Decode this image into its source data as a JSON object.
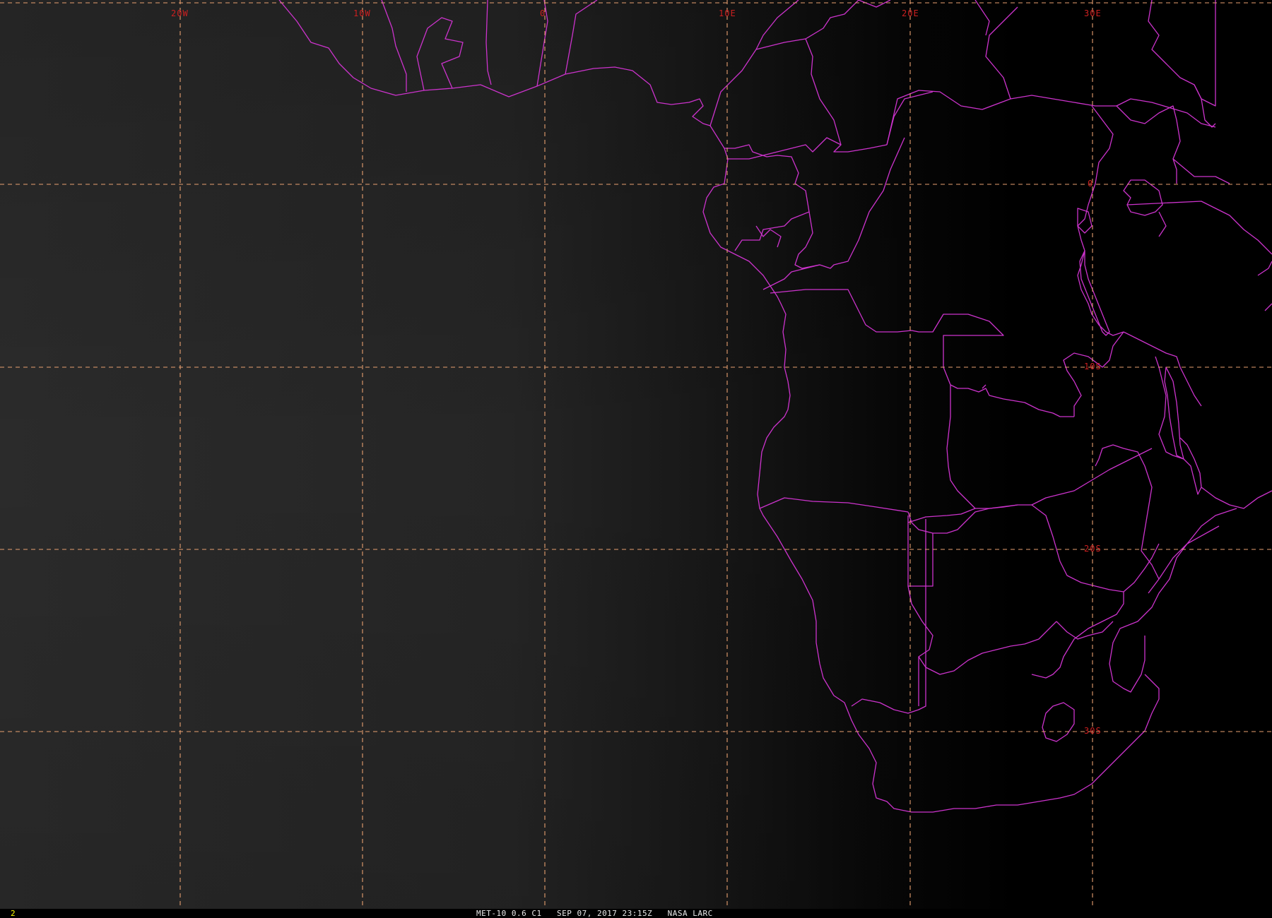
{
  "window": {
    "frame_number": "2"
  },
  "status": {
    "caption": "MET-10 0.6 C1   SEP 07, 2017 23:15Z   NASA LARC"
  },
  "graticule": {
    "line_color": "#e8a070",
    "label_color": "#cc2020",
    "longitude_labels": [
      "20W",
      "10W",
      "0",
      "10E",
      "20E",
      "30E"
    ],
    "latitude_labels": [
      "0",
      "10S",
      "20S",
      "30S"
    ]
  },
  "overlay": {
    "boundary_color": "#cc33cc",
    "background_day": "#2a2a2a",
    "background_night": "#000000"
  }
}
